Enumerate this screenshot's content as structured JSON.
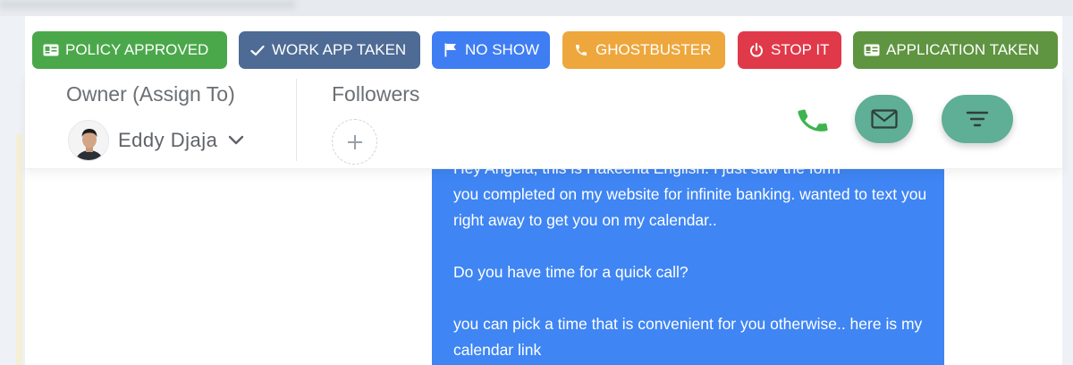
{
  "tags": [
    {
      "label": "POLICY APPROVED",
      "icon": "id-card-icon",
      "color": "#4aa84a"
    },
    {
      "label": "WORK APP TAKEN",
      "icon": "check-icon",
      "color": "#4d6b94"
    },
    {
      "label": "NO SHOW",
      "icon": "flag-icon",
      "color": "#3f7df3"
    },
    {
      "label": "GHOSTBUSTER",
      "icon": "phone-icon",
      "color": "#eea73c"
    },
    {
      "label": "STOP IT",
      "icon": "power-icon",
      "color": "#e0394a"
    },
    {
      "label": "APPLICATION TAKEN",
      "icon": "id-card-icon",
      "color": "#5f9441"
    }
  ],
  "owner": {
    "label": "Owner (Assign To)",
    "name": "Eddy Djaja"
  },
  "followers": {
    "label": "Followers"
  },
  "actions": {
    "phone_color": "#3fb34f",
    "button_color": "#5fae96"
  },
  "message": {
    "partial_first_line": "Hey Angela, this is Hakeena English. I just saw the form",
    "line1": "you completed on my website for infinite banking. wanted to text you right away to get you on my calendar..",
    "line2": "Do you have time for a quick call?",
    "line3": "you can pick a time that is convenient for you otherwise.. here is my calendar link",
    "bubble_color": "#3f85f3"
  }
}
